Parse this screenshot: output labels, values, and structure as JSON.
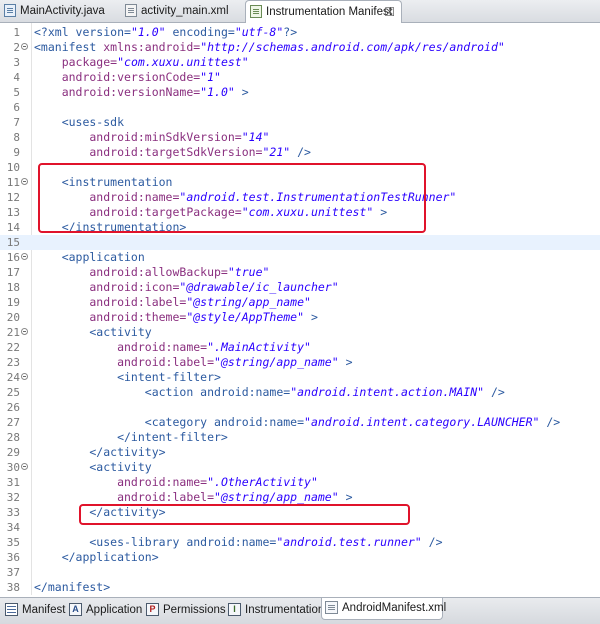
{
  "editor_tabs": [
    {
      "label": "MainActivity.java",
      "icon": "java-file-icon"
    },
    {
      "label": "activity_main.xml",
      "icon": "xml-file-icon"
    },
    {
      "label": "Instrumentation Manifest",
      "icon": "manifest-file-icon",
      "active": true,
      "close": "☒"
    }
  ],
  "code": {
    "l1": {
      "n": "1",
      "a": "<?xml version=",
      "b": "\"1.0\"",
      "c": " encoding=",
      "d": "\"utf-8\"",
      "e": "?>"
    },
    "l2": {
      "n": "2",
      "a": "<manifest ",
      "b": "xmlns:android=",
      "c": "\"http://schemas.android.com/apk/res/android\""
    },
    "l3": {
      "n": "3",
      "a": "    package=",
      "b": "\"com.xuxu.unittest\""
    },
    "l4": {
      "n": "4",
      "a": "    android:versionCode=",
      "b": "\"1\""
    },
    "l5": {
      "n": "5",
      "a": "    android:versionName=",
      "b": "\"1.0\"",
      "c": " >"
    },
    "l6": {
      "n": "6"
    },
    "l7": {
      "n": "7",
      "a": "    <uses-sdk"
    },
    "l8": {
      "n": "8",
      "a": "        android:minSdkVersion=",
      "b": "\"14\""
    },
    "l9": {
      "n": "9",
      "a": "        android:targetSdkVersion=",
      "b": "\"21\"",
      "c": " />"
    },
    "l10": {
      "n": "10"
    },
    "l11": {
      "n": "11",
      "a": "    <instrumentation"
    },
    "l12": {
      "n": "12",
      "a": "        android:name=",
      "b": "\"android.test.InstrumentationTestRunner\""
    },
    "l13": {
      "n": "13",
      "a": "        android:targetPackage=",
      "b": "\"com.xuxu.unittest\"",
      "c": " >"
    },
    "l14": {
      "n": "14",
      "a": "    </instrumentation>"
    },
    "l15": {
      "n": "15"
    },
    "l16": {
      "n": "16",
      "a": "    <application"
    },
    "l17": {
      "n": "17",
      "a": "        android:allowBackup=",
      "b": "\"true\""
    },
    "l18": {
      "n": "18",
      "a": "        android:icon=",
      "b": "\"@drawable/ic_launcher\""
    },
    "l19": {
      "n": "19",
      "a": "        android:label=",
      "b": "\"@string/app_name\""
    },
    "l20": {
      "n": "20",
      "a": "        android:theme=",
      "b": "\"@style/AppTheme\"",
      "c": " >"
    },
    "l21": {
      "n": "21",
      "a": "        <activity"
    },
    "l22": {
      "n": "22",
      "a": "            android:name=",
      "b": "\".MainActivity\""
    },
    "l23": {
      "n": "23",
      "a": "            android:label=",
      "b": "\"@string/app_name\"",
      "c": " >"
    },
    "l24": {
      "n": "24",
      "a": "            <intent-filter>"
    },
    "l25": {
      "n": "25",
      "a": "                <action android:name=",
      "b": "\"android.intent.action.MAIN\"",
      "c": " />"
    },
    "l26": {
      "n": "26"
    },
    "l27": {
      "n": "27",
      "a": "                <category android:name=",
      "b": "\"android.intent.category.LAUNCHER\"",
      "c": " />"
    },
    "l28": {
      "n": "28",
      "a": "            </intent-filter>"
    },
    "l29": {
      "n": "29",
      "a": "        </activity>"
    },
    "l30": {
      "n": "30",
      "a": "        <activity"
    },
    "l31": {
      "n": "31",
      "a": "            android:name=",
      "b": "\".OtherActivity\""
    },
    "l32": {
      "n": "32",
      "a": "            android:label=",
      "b": "\"@string/app_name\"",
      "c": " >"
    },
    "l33": {
      "n": "33",
      "a": "        </activity>"
    },
    "l34": {
      "n": "34"
    },
    "l35": {
      "n": "35",
      "a": "        <uses-library android:name=",
      "b": "\"android.test.runner\"",
      "c": " />"
    },
    "l36": {
      "n": "36",
      "a": "    </application>"
    },
    "l37": {
      "n": "37"
    },
    "l38": {
      "n": "38",
      "a": "</manifest>"
    }
  },
  "bottom_tabs": [
    {
      "label": "Manifest",
      "icon": "manifest-grid-icon"
    },
    {
      "label": "Application",
      "icon": "application-a-icon",
      "glyph": "A"
    },
    {
      "label": "Permissions",
      "icon": "permissions-p-icon",
      "glyph": "P"
    },
    {
      "label": "Instrumentation",
      "icon": "instrumentation-i-icon",
      "glyph": "I"
    },
    {
      "label": "AndroidManifest.xml",
      "icon": "xml-file-icon",
      "active": true
    }
  ],
  "colors": {
    "highlight_box": "#e0132b",
    "current_line": "#e8f2fe",
    "attribute": "#8a2f7f",
    "value": "#2a00ff",
    "tag": "#2c5aa0"
  }
}
